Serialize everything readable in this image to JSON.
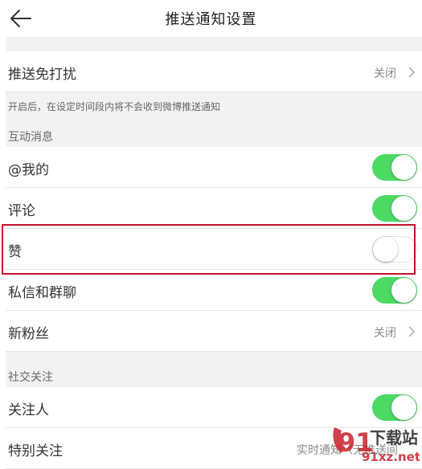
{
  "header": {
    "title": "推送通知设置",
    "back_icon": "arrow-left-icon"
  },
  "dnd": {
    "label": "推送免打扰",
    "value": "关闭"
  },
  "hint": "开启后，在设定时间段内将不会收到微博推送通知",
  "sections": {
    "interaction": "互动消息",
    "social": "社交关注"
  },
  "rows": {
    "mention": {
      "label": "@我的",
      "on": true
    },
    "comment": {
      "label": "评论",
      "on": true
    },
    "like": {
      "label": "赞",
      "on": false
    },
    "dm": {
      "label": "私信和群聊",
      "on": true
    },
    "fans": {
      "label": "新粉丝",
      "value": "关闭"
    },
    "follow": {
      "label": "关注人",
      "on": true
    },
    "special": {
      "label": "特别关注",
      "value": "实时通知（无推送间"
    }
  },
  "watermark": {
    "brand": "下载站",
    "domain": "91xz.net",
    "logo": "91"
  },
  "colors": {
    "toggle_on": "#4cd964",
    "highlight": "#c8102e"
  }
}
